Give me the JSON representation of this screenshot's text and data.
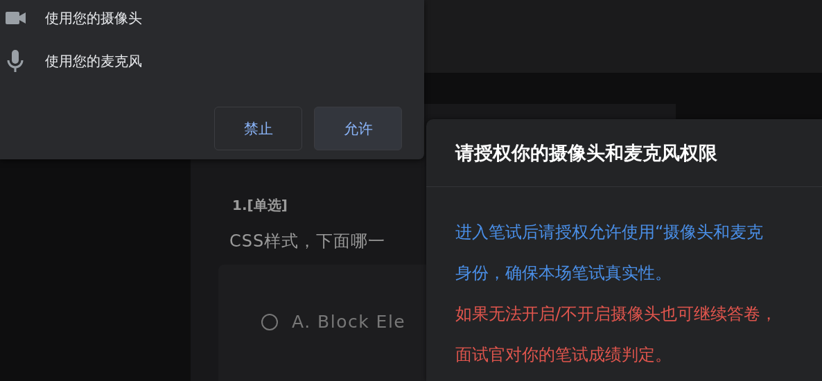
{
  "permission_prompt": {
    "items": [
      {
        "kind": "camera",
        "label": "使用您的摄像头"
      },
      {
        "kind": "microphone",
        "label": "使用您的麦克风"
      }
    ],
    "buttons": [
      {
        "kind": "secondary",
        "label": "禁止"
      },
      {
        "kind": "primary",
        "label": "允许"
      }
    ]
  },
  "question": {
    "number": "1.[单选]",
    "text": "CSS样式，下面哪一",
    "options": [
      {
        "label": "A. Block Ele",
        "selected": false
      }
    ]
  },
  "dialog": {
    "title": "请授权你的摄像头和麦克风权限",
    "lines": [
      {
        "kind": "info",
        "text": "进入笔试后请授权允许使用“摄像头和麦克"
      },
      {
        "kind": "info",
        "text": "身份，确保本场笔试真实性。"
      },
      {
        "kind": "warning",
        "text": "如果无法开启/不开启摄像头也可继续答卷，"
      },
      {
        "kind": "warning",
        "text": "面试官对你的笔试成绩判定。"
      }
    ]
  }
}
